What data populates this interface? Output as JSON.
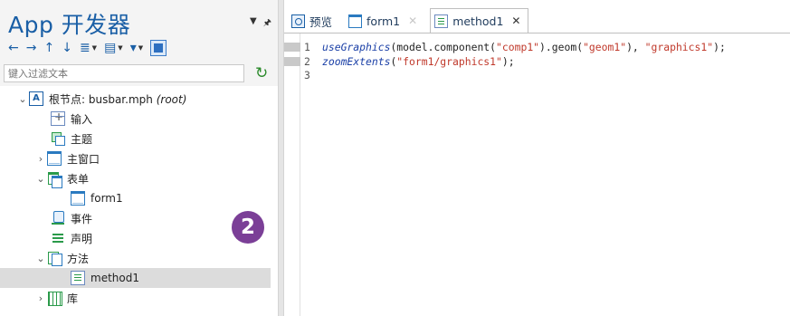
{
  "left": {
    "title": "App 开发器",
    "filter_placeholder": "键入过滤文本",
    "tree": {
      "root": {
        "label": "根节点: busbar.mph",
        "suffix": "(root)",
        "icon_text": "A"
      },
      "items": [
        {
          "label": "输入"
        },
        {
          "label": "主题"
        },
        {
          "label": "主窗口"
        },
        {
          "label": "表单"
        },
        {
          "label": "form1"
        },
        {
          "label": "事件"
        },
        {
          "label": "声明"
        },
        {
          "label": "方法"
        },
        {
          "label": "method1"
        },
        {
          "label": "库"
        }
      ]
    },
    "badge": "2"
  },
  "tabs": [
    {
      "label": "预览",
      "close": ""
    },
    {
      "label": "form1",
      "close": "✕"
    },
    {
      "label": "method1",
      "close": "✕"
    }
  ],
  "editor": {
    "lines": [
      {
        "num": "1",
        "fn": "useGraphics",
        "a": "(model.component(",
        "s1": "\"comp1\"",
        "b": ").geom(",
        "s2": "\"geom1\"",
        "c": "), ",
        "s3": "\"graphics1\"",
        "d": ");"
      },
      {
        "num": "2",
        "fn": "zoomExtents",
        "a": "(",
        "s1": "\"form1/graphics1\"",
        "b": ");"
      },
      {
        "num": "3"
      }
    ]
  }
}
